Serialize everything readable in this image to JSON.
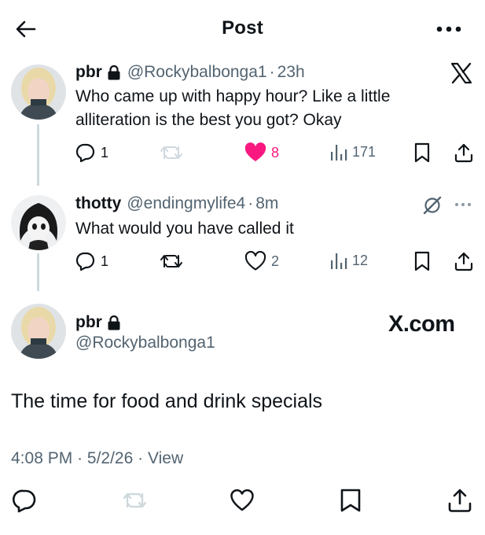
{
  "header": {
    "title": "Post",
    "back_icon": "back-arrow-icon",
    "more_icon": "more-icon"
  },
  "reply_parent": {
    "name": "pbr",
    "handle": "@Rockybalbonga1",
    "separator": "·",
    "time": "23h",
    "text": "Who came up with happy hour? Like a little alliteration is the best you got? Okay",
    "actions": {
      "replies": "1",
      "reposts": "",
      "likes": "8",
      "views": "171"
    },
    "liked": true
  },
  "reply": {
    "name": "thotty",
    "handle": "@endingmylife4",
    "separator": "·",
    "time": "8m",
    "text": "What would you have called it",
    "actions": {
      "replies": "1",
      "reposts": "",
      "likes": "2",
      "views": "12"
    }
  },
  "main_post": {
    "name": "pbr",
    "handle": "@Rockybalbonga1",
    "watermark": "X.com",
    "text": "The time for food and drink specials",
    "time": "4:08 PM",
    "separator": "·",
    "date": "5/2/26",
    "separator2": "·",
    "view_label": "View"
  },
  "colors": {
    "text": "#0f1419",
    "secondary": "#536471",
    "like_pink": "#f91880",
    "line": "#cfd9de"
  }
}
